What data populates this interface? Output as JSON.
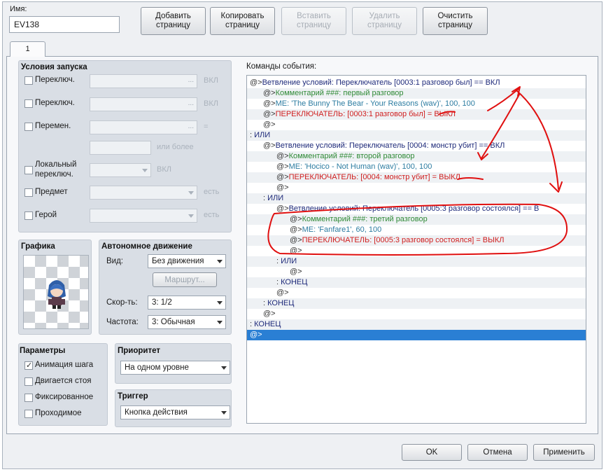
{
  "event": {
    "name_label": "Имя:",
    "name_value": "EV138"
  },
  "toolbar": {
    "add": "Добавить страницу",
    "copy": "Копировать страницу",
    "paste": "Вставить страницу",
    "delete": "Удалить страницу",
    "clear": "Очистить страницу"
  },
  "tab": {
    "label": "1"
  },
  "conditions": {
    "title": "Условия запуска",
    "switch1": "Переключ.",
    "switch2": "Переключ.",
    "variable": "Перемен.",
    "local1": "Локальный",
    "local2": "переключ.",
    "item": "Предмет",
    "actor": "Герой",
    "on": "ВКЛ",
    "eq": "=",
    "or_more": "или более",
    "has": "есть",
    "dots": "..."
  },
  "graphics": {
    "title": "Графика"
  },
  "autonomous": {
    "title": "Автономное движение",
    "type_label": "Вид:",
    "type_value": "Без движения",
    "route": "Маршрут...",
    "speed_label": "Скор-ть:",
    "speed_value": "3: 1/2",
    "freq_label": "Частота:",
    "freq_value": "3: Обычная"
  },
  "options": {
    "title": "Параметры",
    "walk": "Анимация шага",
    "stepping": "Двигается стоя",
    "direction_fix": "Фиксированное",
    "through": "Проходимое"
  },
  "priority": {
    "title": "Приоритет",
    "value": "На одном уровне"
  },
  "trigger": {
    "title": "Триггер",
    "value": "Кнопка действия"
  },
  "commands": {
    "label": "Команды события:",
    "rows": [
      {
        "indent": 0,
        "prefix": "@>",
        "text": "Ветвление условий: Переключатель [0003:1 разговор был] == ВКЛ",
        "kind": "cond"
      },
      {
        "indent": 1,
        "prefix": "@>",
        "text": "Комментарий ###: первый разговор",
        "kind": "com"
      },
      {
        "indent": 1,
        "prefix": "@>",
        "text": "ME: 'The Bunny The Bear - Your Reasons (wav)', 100, 100",
        "kind": "me"
      },
      {
        "indent": 1,
        "prefix": "@>",
        "text": "ПЕРЕКЛЮЧАТЕЛЬ: [0003:1 разговор был] = ВЫКЛ",
        "kind": "sw"
      },
      {
        "indent": 1,
        "prefix": "@>",
        "text": "",
        "kind": "at"
      },
      {
        "indent": 0,
        "prefix": " : ",
        "text": "ИЛИ",
        "kind": "cond"
      },
      {
        "indent": 1,
        "prefix": "@>",
        "text": "Ветвление условий: Переключатель [0004: монстр убит] == ВКЛ",
        "kind": "cond"
      },
      {
        "indent": 2,
        "prefix": "@>",
        "text": "Комментарий ###: второй разговор",
        "kind": "com"
      },
      {
        "indent": 2,
        "prefix": "@>",
        "text": "ME: 'Hocico - Not Human (wav)', 100, 100",
        "kind": "me"
      },
      {
        "indent": 2,
        "prefix": "@>",
        "text": "ПЕРЕКЛЮЧАТЕЛЬ: [0004: монстр убит] = ВЫКЛ",
        "kind": "sw"
      },
      {
        "indent": 2,
        "prefix": "@>",
        "text": "",
        "kind": "at"
      },
      {
        "indent": 1,
        "prefix": " : ",
        "text": "ИЛИ",
        "kind": "cond"
      },
      {
        "indent": 2,
        "prefix": "@>",
        "text": "Ветвление условий: Переключатель [0005:3 разговор состоялся] == В",
        "kind": "cond"
      },
      {
        "indent": 3,
        "prefix": "@>",
        "text": "Комментарий ###: третий разговор",
        "kind": "com"
      },
      {
        "indent": 3,
        "prefix": "@>",
        "text": "ME: 'Fanfare1', 60, 100",
        "kind": "me"
      },
      {
        "indent": 3,
        "prefix": "@>",
        "text": "ПЕРЕКЛЮЧАТЕЛЬ: [0005:3 разговор состоялся] = ВЫКЛ",
        "kind": "sw"
      },
      {
        "indent": 3,
        "prefix": "@>",
        "text": "",
        "kind": "at"
      },
      {
        "indent": 2,
        "prefix": " : ",
        "text": "ИЛИ",
        "kind": "cond"
      },
      {
        "indent": 3,
        "prefix": "@>",
        "text": "",
        "kind": "at"
      },
      {
        "indent": 2,
        "prefix": " : ",
        "text": "КОНЕЦ",
        "kind": "cond"
      },
      {
        "indent": 2,
        "prefix": "@>",
        "text": "",
        "kind": "at"
      },
      {
        "indent": 1,
        "prefix": " : ",
        "text": "КОНЕЦ",
        "kind": "cond"
      },
      {
        "indent": 1,
        "prefix": "@>",
        "text": "",
        "kind": "at"
      },
      {
        "indent": 0,
        "prefix": " : ",
        "text": "КОНЕЦ",
        "kind": "cond"
      },
      {
        "indent": 0,
        "prefix": "@>",
        "text": "",
        "kind": "selected"
      }
    ]
  },
  "footer": {
    "ok": "OK",
    "cancel": "Отмена",
    "apply": "Применить"
  },
  "colors": {
    "selection": "#2a7fd4",
    "annotation": "#e01010",
    "switch_text": "#d01e1e",
    "comment_text": "#2f8a36"
  }
}
